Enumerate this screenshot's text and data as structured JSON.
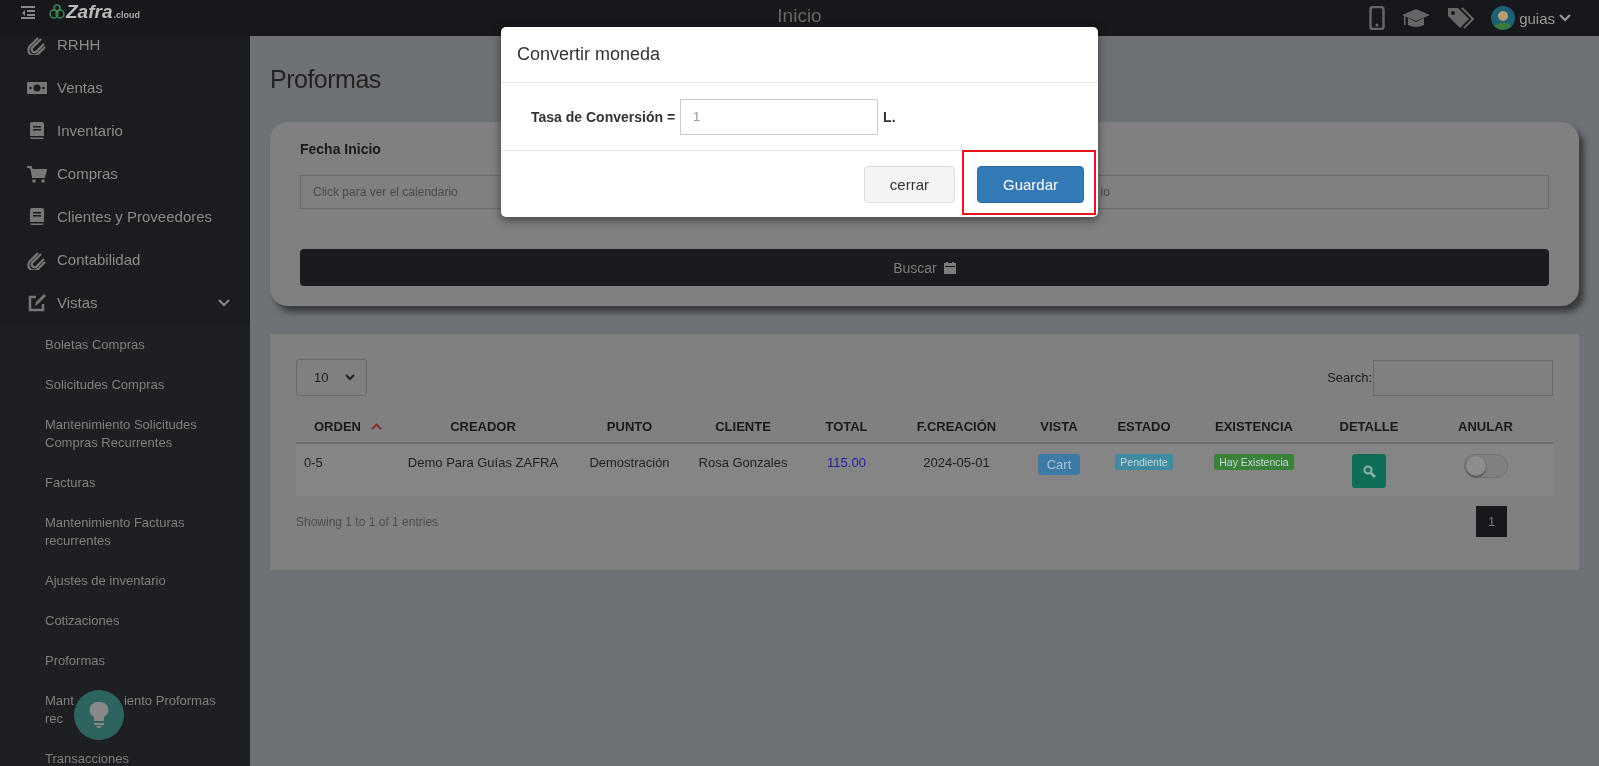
{
  "topbar": {
    "logo": {
      "name": "Zafra",
      "suffix": ".cloud"
    },
    "title": "Inicio",
    "user": "guias"
  },
  "sidebar": {
    "items": [
      {
        "label": "RRHH"
      },
      {
        "label": "Ventas"
      },
      {
        "label": "Inventario"
      },
      {
        "label": "Compras"
      },
      {
        "label": "Clientes y Proveedores"
      },
      {
        "label": "Contabilidad"
      },
      {
        "label": "Vistas",
        "expanded": true,
        "children": [
          "Boletas Compras",
          "Solicitudes Compras",
          "Mantenimiento Solicitudes Compras Recurrentes",
          "Facturas",
          "Mantenimiento Facturas recurrentes",
          "Ajustes de inventario",
          "Cotizaciones",
          "Proformas",
          {
            "covered": true,
            "lines": [
              [
                "Mant",
                "iento Proformas"
              ],
              [
                "rec"
              ]
            ]
          },
          "Transacciones"
        ]
      }
    ]
  },
  "page_title": "Proformas",
  "filters": [
    {
      "label": "Fecha Inicio",
      "placeholder": "Click para ver el calendario"
    },
    {
      "placeholder": "io"
    }
  ],
  "search_button": "Buscar",
  "table": {
    "page_size": "10",
    "search_label": "Search:",
    "columns": [
      {
        "label": "ORDEN",
        "sorted": true
      },
      {
        "label": "CREADOR",
        "sorted": false
      },
      {
        "label": "PUNTO",
        "sorted": false
      },
      {
        "label": "CLIENTE",
        "sorted": false
      },
      {
        "label": "TOTAL",
        "sorted": false
      },
      {
        "label": "F.CREACIÓN",
        "sorted": false
      },
      {
        "label": "VISTA",
        "sorted": false
      },
      {
        "label": "ESTADO",
        "sorted": false
      },
      {
        "label": "EXISTENCIA",
        "sorted": false
      },
      {
        "label": "DETALLE",
        "sorted": false
      },
      {
        "label": "ANULAR",
        "sorted": false
      }
    ],
    "rows": [
      {
        "orden": "0-5",
        "creador": "Demo Para Guías ZAFRA",
        "punto": "Demostración",
        "cliente": "Rosa Gonzales",
        "total": "115.00",
        "fecha": "2024-05-01",
        "vista": "Cart",
        "estado": "Pendiente",
        "existencia": "Hay Existencia",
        "anular": false
      }
    ],
    "info": "Showing 1 to 1 of 1 entries",
    "pages": [
      {
        "label": "1",
        "selected": true
      }
    ]
  },
  "modal": {
    "title": "Convertir moneda",
    "field_label": "Tasa de Conversión =",
    "placeholder": "1",
    "unit": "L.",
    "buttons": [
      {
        "label": "cerrar",
        "kind": "default",
        "highlighted": false
      },
      {
        "label": "Guardar",
        "kind": "primary",
        "highlighted": true
      }
    ]
  }
}
